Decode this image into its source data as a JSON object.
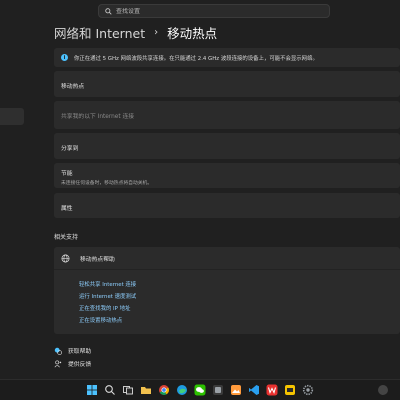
{
  "search": {
    "placeholder": "查找设置"
  },
  "breadcrumb": {
    "parent": "网络和 Internet",
    "current": "移动热点"
  },
  "info": {
    "text": "你正在通过 5 GHz 网络波段共享连接。在只能通过 2.4 GHz 波段连接的设备上，可能不会显示网络。"
  },
  "rows": {
    "hotspot": "移动热点",
    "share_from": "共享我的以下 Internet 连接",
    "band": "分享到",
    "power_title": "节能",
    "power_desc": "未连接任何设备时，移动热点将自动关机。",
    "properties": "属性"
  },
  "related": {
    "title": "相关支持",
    "help_title": "移动热点帮助",
    "links": [
      "轻松共享 Internet 连接",
      "运行 Internet 速度测试",
      "正在查找我的 IP 地址",
      "正在设置移动热点"
    ]
  },
  "footer": {
    "get_help": "获取帮助",
    "feedback": "提供反馈"
  },
  "taskbar": {
    "icons": [
      "windows-start-icon",
      "search-icon",
      "task-view-icon",
      "file-explorer-icon",
      "chrome-icon",
      "edge-icon",
      "wechat-icon",
      "app-icon",
      "photos-icon",
      "vscode-icon",
      "wps-icon",
      "app-yellow-icon",
      "settings-icon"
    ]
  },
  "colors": {
    "accent": "#4cc2ff",
    "link": "#8fd0ff",
    "background": "#202020",
    "card": "#2b2b2b"
  }
}
